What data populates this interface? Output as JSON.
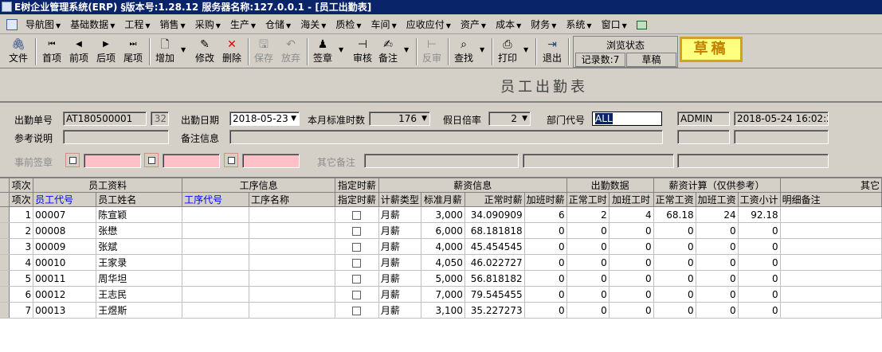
{
  "window": {
    "title": "E树企业管理系统(ERP) §版本号:1.28.12 服务器名称:127.0.0.1 - [员工出勤表]"
  },
  "menu": {
    "items": [
      "导航图",
      "基础数据",
      "工程",
      "销售",
      "采购",
      "生产",
      "仓储",
      "海关",
      "质检",
      "车间",
      "应收应付",
      "资产",
      "成本",
      "财务",
      "系统",
      "窗口"
    ]
  },
  "toolbar": {
    "file": "文件",
    "first": "首项",
    "prev": "前项",
    "next": "后项",
    "last": "尾项",
    "add": "增加",
    "edit": "修改",
    "delete": "删除",
    "save": "保存",
    "discard": "放弃",
    "sign": "签章",
    "audit": "审核",
    "remark": "备注",
    "unaudit": "反审",
    "find": "查找",
    "print": "打印",
    "exit": "退出"
  },
  "status": {
    "title": "浏览状态",
    "records": "记录数:7",
    "state": "草稿"
  },
  "draft_stamp": "草稿",
  "form": {
    "title": "员工出勤表",
    "doc_no_label": "出勤单号",
    "doc_no": "AT180500001",
    "doc_no_extra": "32",
    "date_label": "出勤日期",
    "date": "2018-05-23",
    "std_hours_label": "本月标准时数",
    "std_hours": "176",
    "holiday_rate_label": "假日倍率",
    "holiday_rate": "2",
    "dept_label": "部门代号",
    "dept": "ALL",
    "user": "ADMIN",
    "timestamp": "2018-05-24 16:02:20",
    "ref_label": "参考说明",
    "note_label": "备注信息",
    "pre_sign_label": "事前签章",
    "other_note_label": "其它备注"
  },
  "grid": {
    "group_headers": [
      "项次",
      "员工资料",
      "工序信息",
      "指定时薪",
      "薪资信息",
      "出勤数据",
      "薪资计算（仅供参考）",
      "其它"
    ],
    "headers": [
      "项次",
      "员工代号",
      "员工姓名",
      "工序代号",
      "工序名称",
      "指定时薪",
      "计薪类型",
      "标准月薪",
      "正常时薪",
      "加班时薪",
      "正常工时",
      "加班工时",
      "正常工资",
      "加班工资",
      "工资小计",
      "明细备注"
    ],
    "rows": [
      {
        "no": "1",
        "code": "00007",
        "name": "陈宣颖",
        "type": "月薪",
        "salary": "3,000",
        "rate": "34.090909",
        "ot_rate": "6",
        "hours": "2",
        "ot_hours": "4",
        "pay": "68.18",
        "ot_pay": "24",
        "total": "92.18"
      },
      {
        "no": "2",
        "code": "00008",
        "name": "张懋",
        "type": "月薪",
        "salary": "6,000",
        "rate": "68.181818",
        "ot_rate": "0",
        "hours": "0",
        "ot_hours": "0",
        "pay": "0",
        "ot_pay": "0",
        "total": "0"
      },
      {
        "no": "3",
        "code": "00009",
        "name": "张斌",
        "type": "月薪",
        "salary": "4,000",
        "rate": "45.454545",
        "ot_rate": "0",
        "hours": "0",
        "ot_hours": "0",
        "pay": "0",
        "ot_pay": "0",
        "total": "0"
      },
      {
        "no": "4",
        "code": "00010",
        "name": "王家录",
        "type": "月薪",
        "salary": "4,050",
        "rate": "46.022727",
        "ot_rate": "0",
        "hours": "0",
        "ot_hours": "0",
        "pay": "0",
        "ot_pay": "0",
        "total": "0"
      },
      {
        "no": "5",
        "code": "00011",
        "name": "周华坦",
        "type": "月薪",
        "salary": "5,000",
        "rate": "56.818182",
        "ot_rate": "0",
        "hours": "0",
        "ot_hours": "0",
        "pay": "0",
        "ot_pay": "0",
        "total": "0"
      },
      {
        "no": "6",
        "code": "00012",
        "name": "王志民",
        "type": "月薪",
        "salary": "7,000",
        "rate": "79.545455",
        "ot_rate": "0",
        "hours": "0",
        "ot_hours": "0",
        "pay": "0",
        "ot_pay": "0",
        "total": "0"
      },
      {
        "no": "7",
        "code": "00013",
        "name": "王煜斯",
        "type": "月薪",
        "salary": "3,100",
        "rate": "35.227273",
        "ot_rate": "0",
        "hours": "0",
        "ot_hours": "0",
        "pay": "0",
        "ot_pay": "0",
        "total": "0"
      }
    ]
  }
}
